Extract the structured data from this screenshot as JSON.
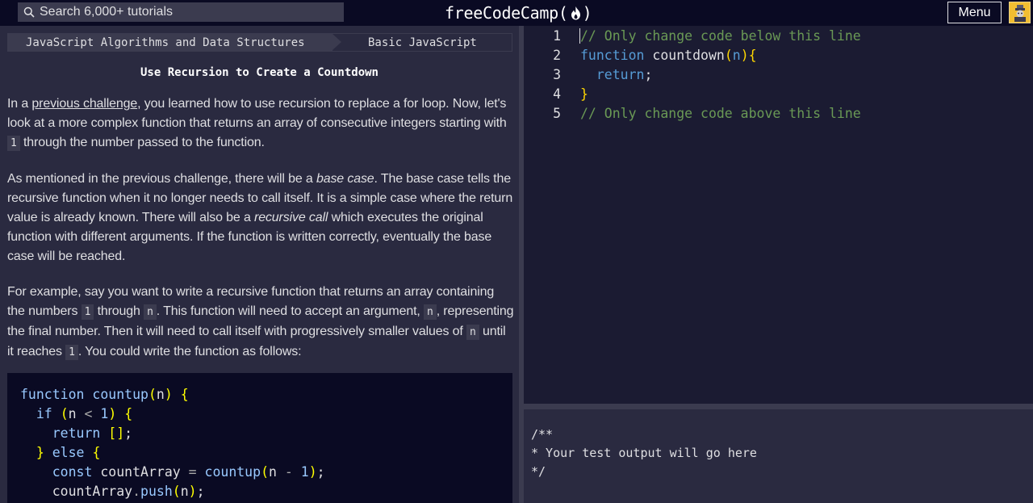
{
  "nav": {
    "search_placeholder": "Search 6,000+ tutorials",
    "logo_text": "freeCodeCamp(",
    "logo_close": ")",
    "menu_label": "Menu"
  },
  "breadcrumb": {
    "superblock": "JavaScript Algorithms and Data Structures",
    "block": "Basic JavaScript"
  },
  "challenge": {
    "title": "Use Recursion to Create a Countdown",
    "p1_a": "In a ",
    "p1_link": "previous challenge",
    "p1_b": ", you learned how to use recursion to replace a for loop. Now, let's look at a more complex function that returns an array of consecutive integers starting with ",
    "p1_code": "1",
    "p1_c": " through the number passed to the function.",
    "p2_a": "As mentioned in the previous challenge, there will be a ",
    "p2_em1": "base case",
    "p2_b": ". The base case tells the recursive function when it no longer needs to call itself. It is a simple case where the return value is already known. There will also be a ",
    "p2_em2": "recursive call",
    "p2_c": " which executes the original function with different arguments. If the function is written correctly, eventually the base case will be reached.",
    "p3_a": "For example, say you want to write a recursive function that returns an array containing the numbers ",
    "p3_code1": "1",
    "p3_b": " through ",
    "p3_code2": "n",
    "p3_c": ". This function will need to accept an argument, ",
    "p3_code3": "n",
    "p3_d": ", representing the final number. Then it will need to call itself with progressively smaller values of ",
    "p3_code4": "n",
    "p3_e": " until it reaches ",
    "p3_code5": "1",
    "p3_f": ". You could write the function as follows:"
  },
  "example": {
    "l1": [
      "function",
      " ",
      "countup",
      "(",
      "n",
      ")",
      " ",
      "{"
    ],
    "l2": [
      "  ",
      "if",
      " ",
      "(",
      "n",
      " < ",
      "1",
      ")",
      " ",
      "{"
    ],
    "l3": [
      "    ",
      "return",
      " ",
      "[]",
      ";"
    ],
    "l4": [
      "  ",
      "}",
      " ",
      "else",
      " ",
      "{"
    ],
    "l5": [
      "    ",
      "const",
      " countArray ",
      "=",
      " ",
      "countup",
      "(",
      "n",
      " - ",
      "1",
      ")",
      ";"
    ],
    "l6": [
      "    countArray",
      ".",
      "push",
      "(",
      "n",
      ")",
      ";"
    ]
  },
  "editor": {
    "line_numbers": [
      "1",
      "2",
      "3",
      "4",
      "5"
    ],
    "l1": "// Only change code below this line",
    "l2_kw": "function",
    "l2_name": " countdown",
    "l2_open": "(",
    "l2_arg": "n",
    "l2_close": ")",
    "l2_brace": "{",
    "l3_kw": "  return",
    "l3_semi": ";",
    "l4": "}",
    "l5": "// Only change code above this line"
  },
  "output": {
    "text": "/**\n* Your test output will go here\n*/"
  },
  "colors": {
    "background": "#0a0a23",
    "panel": "#2a2a40",
    "editor": "#1b1b32",
    "accent_yellow": "#f1be32"
  },
  "icons": [
    "search-icon",
    "flame-icon",
    "avatar-icon"
  ]
}
